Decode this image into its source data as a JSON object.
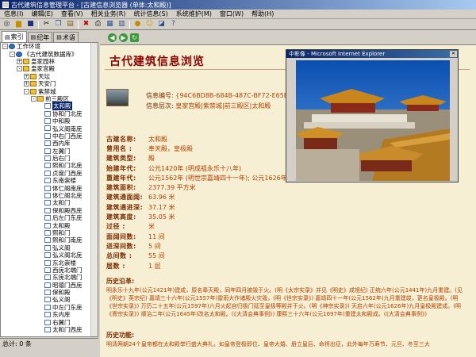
{
  "window": {
    "title": "古代建筑信息管理平台 - [古建信息浏览器 (单体:太和殿)]"
  },
  "menu": [
    "信息(I)",
    "编辑(E)",
    "查看(V)",
    "相关业务(R)",
    "统计信息(S)",
    "系统维护(M)",
    "窗口(W)",
    "帮助(H)"
  ],
  "left_tabs": [
    "索引",
    "纪年",
    "术语"
  ],
  "tree": [
    {
      "label": "工作环境",
      "depth": 0,
      "icon": "globe",
      "exp": "-"
    },
    {
      "label": "《古代建筑数据库》",
      "depth": 1,
      "icon": "globe",
      "exp": "-"
    },
    {
      "label": "皇家园林",
      "depth": 2,
      "icon": "folder",
      "exp": "+"
    },
    {
      "label": "皇家宫殿",
      "depth": 2,
      "icon": "folder",
      "exp": "-"
    },
    {
      "label": "天坛",
      "depth": 3,
      "icon": "folder",
      "exp": "+"
    },
    {
      "label": "天安门",
      "depth": 3,
      "icon": "folder",
      "exp": "+"
    },
    {
      "label": "紫禁城",
      "depth": 3,
      "icon": "folder",
      "exp": "-"
    },
    {
      "label": "前三殿区",
      "depth": 4,
      "icon": "folder",
      "exp": "-"
    },
    {
      "label": "太和殿",
      "depth": 5,
      "icon": "page",
      "exp": "",
      "selected": true
    },
    {
      "label": "协和门北庑",
      "depth": 5,
      "icon": "page",
      "exp": ""
    },
    {
      "label": "中和殿",
      "depth": 5,
      "icon": "page",
      "exp": ""
    },
    {
      "label": "弘义阁南庑",
      "depth": 5,
      "icon": "page",
      "exp": ""
    },
    {
      "label": "中右门西庑",
      "depth": 5,
      "icon": "page",
      "exp": ""
    },
    {
      "label": "西内库",
      "depth": 5,
      "icon": "page",
      "exp": ""
    },
    {
      "label": "左翼门",
      "depth": 5,
      "icon": "page",
      "exp": ""
    },
    {
      "label": "后右门",
      "depth": 5,
      "icon": "page",
      "exp": ""
    },
    {
      "label": "熙和门北庑",
      "depth": 5,
      "icon": "page",
      "exp": ""
    },
    {
      "label": "贞度门西庑",
      "depth": 5,
      "icon": "page",
      "exp": ""
    },
    {
      "label": "东南崇楼",
      "depth": 5,
      "icon": "page",
      "exp": ""
    },
    {
      "label": "体仁阁南庑",
      "depth": 5,
      "icon": "page",
      "exp": ""
    },
    {
      "label": "体仁阁北庑",
      "depth": 5,
      "icon": "page",
      "exp": ""
    },
    {
      "label": "太和门",
      "depth": 5,
      "icon": "page",
      "exp": ""
    },
    {
      "label": "保和殿西庑",
      "depth": 5,
      "icon": "page",
      "exp": ""
    },
    {
      "label": "后左门东庑",
      "depth": 5,
      "icon": "page",
      "exp": ""
    },
    {
      "label": "太和殿",
      "depth": 5,
      "icon": "page",
      "exp": ""
    },
    {
      "label": "熙和门",
      "depth": 5,
      "icon": "page",
      "exp": ""
    },
    {
      "label": "熙和门南庑",
      "depth": 5,
      "icon": "page",
      "exp": ""
    },
    {
      "label": "弘义阁",
      "depth": 5,
      "icon": "page",
      "exp": ""
    },
    {
      "label": "弘义阁北庑",
      "depth": 5,
      "icon": "page",
      "exp": ""
    },
    {
      "label": "东北崇楼",
      "depth": 5,
      "icon": "page",
      "exp": ""
    },
    {
      "label": "西庑北端门",
      "depth": 5,
      "icon": "page",
      "exp": ""
    },
    {
      "label": "东庑北端门",
      "depth": 5,
      "icon": "page",
      "exp": ""
    },
    {
      "label": "昭德门西庑",
      "depth": 5,
      "icon": "page",
      "exp": ""
    },
    {
      "label": "保和殿",
      "depth": 5,
      "icon": "page",
      "exp": ""
    },
    {
      "label": "弘义阁",
      "depth": 5,
      "icon": "page",
      "exp": ""
    },
    {
      "label": "中左门东庑",
      "depth": 5,
      "icon": "page",
      "exp": ""
    },
    {
      "label": "东内库",
      "depth": 5,
      "icon": "page",
      "exp": ""
    },
    {
      "label": "右翼门",
      "depth": 5,
      "icon": "page",
      "exp": ""
    },
    {
      "label": "太和门西庑",
      "depth": 5,
      "icon": "page",
      "exp": ""
    }
  ],
  "status": {
    "total": "总计: 0 条"
  },
  "doc": {
    "title": "古代建筑信息浏览",
    "info_code_label": "信息编号:",
    "info_code_value": "{94C6BD8B-684B-487C-BF72-E65E",
    "info_level_label": "信息层次:",
    "info_level_value": "皇家宫殿|紫禁城|前三殿区|太和殿",
    "fields": [
      {
        "label": "古建名称:",
        "value": "太和殿"
      },
      {
        "label": "曾用名 :",
        "value": "奉天殿，皇极殿"
      },
      {
        "label": "建筑类型:",
        "value": "殿"
      },
      {
        "label": "始建年代:",
        "value": "公元1420年 (明成祖永乐十八年)"
      },
      {
        "label": "重建年代:",
        "value": "公元1562年 (明世宗嘉靖四十一年); 公元1626年"
      },
      {
        "label": "建筑面积:",
        "value": "2377.39 平方米"
      },
      {
        "label": "建筑通面阔:",
        "value": "63.96 米"
      },
      {
        "label": "建筑通进深:",
        "value": "37.17 米"
      },
      {
        "label": "建筑高度:",
        "value": "35.05 米"
      },
      {
        "label": "过径 :",
        "value": "米"
      },
      {
        "label": "面阔间数:",
        "value": "11 间"
      },
      {
        "label": "进深间数:",
        "value": "5 间"
      },
      {
        "label": "总间数 :",
        "value": "55 间"
      },
      {
        "label": "层数 :",
        "value": "1 层"
      }
    ],
    "history_title": "历史沿革:",
    "history_text": "明永乐十九年(公元1421年)建成，原名奉天殿，同年四月被毁于火。(明《太宗实录》并见《明史》成祖纪) 正统六年(公元1441年)九月重建。(见《明史》英宗纪) 嘉靖三十六年(公元1557年)雷雨大作诸殿火灾毁，(明《世宗实录》) 嘉靖四十一年(公元1562年)九月重建竣，更名皇极殿。(明《世宗实录》) 万历二十五年(公元1597年)六月火起自归极门延至皇极等殿并于火。(明《神宗实录》) 天启六年(公元1626年)九月皇极殿建成。(明《熹宗实录》) 顺治二年(公元1645年)改名太和殿。(《大清会典事例》) 康熙三十六年(公元1697年)重建太和殿成。(《大清会典事例》)",
    "function_title": "历史功能:",
    "function_text": "明清两朝24个皇帝都在太和殿举行盛大典礼，如皇帝登极即位、皇帝大婚、册立皇后、命将出征，此外每年万寿节、元旦、冬至三大"
  },
  "popup": {
    "title": "中影像 - Microsoft Internet Explorer"
  },
  "colors": {
    "doc_bg": "#f7efd3",
    "label": "#7a2a00",
    "value": "#b04000",
    "title_red": "#8b0000"
  }
}
